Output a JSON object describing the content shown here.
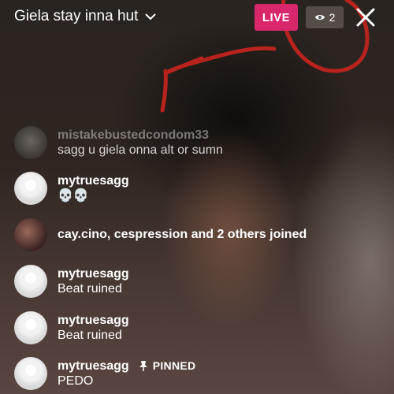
{
  "header": {
    "title": "Giela stay inna hut",
    "live_label": "LIVE",
    "viewer_count": "2"
  },
  "comments": [
    {
      "username": "mistakebustedcondom33",
      "message": "sagg u giela onna alt or sumn"
    },
    {
      "username": "mytruesagg",
      "message": "💀💀"
    },
    {
      "joined_text": "cay.cino, cespression and 2 others joined"
    },
    {
      "username": "mytruesagg",
      "message": "Beat ruined"
    },
    {
      "username": "mytruesagg",
      "message": "Beat ruined"
    },
    {
      "username": "mytruesagg",
      "pinned_label": "PINNED",
      "message": "PEDO"
    }
  ],
  "colors": {
    "live_badge": "#d9276c",
    "annotation_red": "#b8231d"
  }
}
